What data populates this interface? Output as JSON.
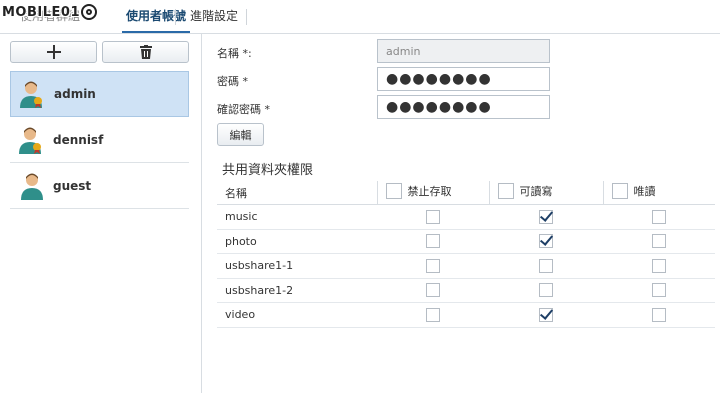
{
  "watermark": "MOBILE01",
  "tabs": [
    {
      "label": "使用者群組"
    },
    {
      "label": "使用者帳號"
    },
    {
      "label": "進階設定"
    }
  ],
  "toolbar": {
    "add_icon": "plus-icon",
    "delete_icon": "trash-icon"
  },
  "users": [
    {
      "name": "admin",
      "selected": true,
      "icon": "admin-user-icon"
    },
    {
      "name": "dennisf",
      "icon": "admin-user-icon"
    },
    {
      "name": "guest",
      "icon": "user-icon"
    }
  ],
  "form": {
    "name_label": "名稱 *:",
    "name_value": "admin",
    "password_label": "密碼 *",
    "password_value": "●●●●●●●●",
    "confirm_label": "確認密碼 *",
    "confirm_value": "●●●●●●●●",
    "edit_button": "編輯"
  },
  "permissions": {
    "title": "共用資料夾權限",
    "columns": {
      "name": "名稱",
      "deny": "禁止存取",
      "rw": "可讀寫",
      "ro": "唯讀"
    },
    "rows": [
      {
        "name": "music",
        "deny": false,
        "rw": true,
        "ro": false
      },
      {
        "name": "photo",
        "deny": false,
        "rw": true,
        "ro": false
      },
      {
        "name": "usbshare1-1",
        "deny": false,
        "rw": false,
        "ro": false
      },
      {
        "name": "usbshare1-2",
        "deny": false,
        "rw": false,
        "ro": false
      },
      {
        "name": "video",
        "deny": false,
        "rw": true,
        "ro": false
      }
    ]
  },
  "colors": {
    "accent": "#2a6aa8",
    "selected_bg": "#cfe2f5",
    "check": "#1e3f66"
  }
}
